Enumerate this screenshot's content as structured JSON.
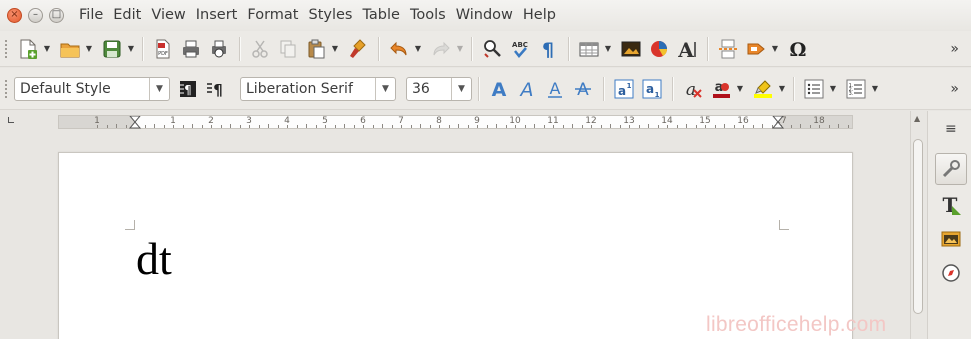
{
  "window": {
    "close_glyph": "×",
    "minimize_glyph": "–",
    "maximize_glyph": "□"
  },
  "menu": [
    "File",
    "Edit",
    "View",
    "Insert",
    "Format",
    "Styles",
    "Table",
    "Tools",
    "Window",
    "Help"
  ],
  "standard_toolbar": {
    "icons": [
      "new-document-icon",
      "open-folder-icon",
      "save-icon",
      "export-pdf-icon",
      "print-icon",
      "print-preview-icon",
      "cut-icon",
      "copy-icon",
      "paste-icon",
      "clone-formatting-icon",
      "undo-icon",
      "redo-icon",
      "find-replace-icon",
      "spelling-icon",
      "formatting-marks-icon",
      "insert-table-icon",
      "insert-image-icon",
      "insert-chart-icon",
      "insert-fontwork-icon",
      "insert-page-break-icon",
      "insert-field-icon",
      "special-character-icon"
    ],
    "more_label": "»"
  },
  "formatting_toolbar": {
    "paragraph_style": "Default Style",
    "font_name": "Liberation Serif",
    "font_size": "36",
    "icons": [
      "update-style-icon",
      "new-style-icon",
      "bold-icon",
      "italic-icon",
      "underline-icon",
      "strikethrough-icon",
      "superscript-icon",
      "subscript-icon",
      "clear-formatting-icon",
      "font-color-icon",
      "highlighting-icon",
      "bullets-icon",
      "numbering-icon"
    ],
    "more_label": "»"
  },
  "ruler": {
    "numbers": [
      "1",
      "1",
      "2",
      "3",
      "4",
      "5",
      "6",
      "7",
      "8",
      "9",
      "10",
      "11",
      "12",
      "13",
      "14",
      "15",
      "16",
      "17",
      "18"
    ]
  },
  "document": {
    "text": "dt"
  },
  "sidebar": {
    "menu_glyph": "≡",
    "icons": [
      "properties-icon",
      "styles-icon",
      "gallery-icon",
      "navigator-icon"
    ]
  },
  "watermark": "libreofficehelp.com"
}
